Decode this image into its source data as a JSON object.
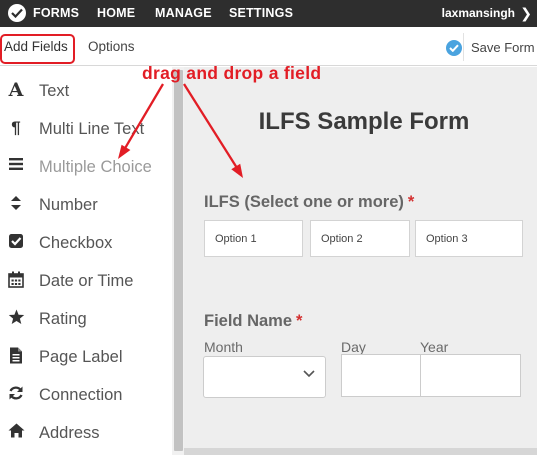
{
  "topbar": {
    "logo_icon": "check-circle-icon",
    "nav": [
      "FORMS",
      "HOME",
      "MANAGE",
      "SETTINGS"
    ],
    "username": "laxmansingh",
    "user_menu_icon": "chevron-right-icon"
  },
  "subbar": {
    "tabs": [
      "Add Fields",
      "Options"
    ],
    "active_tab": "Add Fields",
    "save_label": "Save Form",
    "save_icon": "check-circle-icon"
  },
  "sidebar": {
    "items": [
      {
        "label": "Text",
        "icon": "font-icon"
      },
      {
        "label": "Multi Line Text",
        "icon": "paragraph-icon"
      },
      {
        "label": "Multiple Choice",
        "icon": "list-icon"
      },
      {
        "label": "Number",
        "icon": "sort-icon"
      },
      {
        "label": "Checkbox",
        "icon": "checkbox-icon"
      },
      {
        "label": "Date or Time",
        "icon": "calendar-icon"
      },
      {
        "label": "Rating",
        "icon": "star-icon"
      },
      {
        "label": "Page Label",
        "icon": "document-icon"
      },
      {
        "label": "Connection",
        "icon": "refresh-icon"
      },
      {
        "label": "Address",
        "icon": "home-icon"
      }
    ]
  },
  "form": {
    "title": "ILFS Sample Form",
    "field1": {
      "label": "ILFS (Select one or more)",
      "required_mark": "*",
      "options": [
        "Option 1",
        "Option 2",
        "Option 3"
      ]
    },
    "field2": {
      "label": "Field Name",
      "required_mark": "*",
      "month_label": "Month",
      "day_label": "Day",
      "year_label": "Year"
    }
  },
  "annotation": {
    "text": "drag and drop a field"
  },
  "colors": {
    "topbar": "#2e2e2e",
    "annotation_red": "#e21d25",
    "accent_blue": "#4aa3df",
    "canvas_bg": "#eeeeee",
    "required_red": "#d32f2f"
  }
}
